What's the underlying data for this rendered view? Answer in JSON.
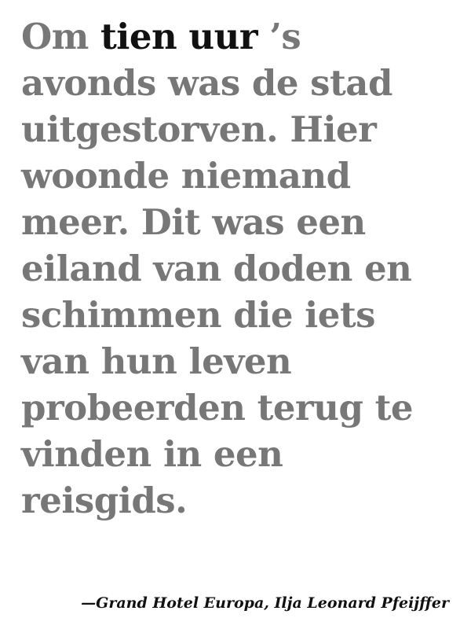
{
  "quote": {
    "lead": "Om ",
    "highlight": "tien uur",
    "rest": " ’s\navonds was de stad\nuitgestorven. Hier\nwoonde niemand\nmeer. Dit was een\neiland van doden en\nschimmen die iets\nvan hun leven\nprobeerden terug te\nvinden in een\nreisgids."
  },
  "attribution": "—Grand Hotel Europa, Ilja Leonard Pfeijffer",
  "colors": {
    "body_text": "#777777",
    "highlight_text": "#111111",
    "background": "#ffffff"
  }
}
